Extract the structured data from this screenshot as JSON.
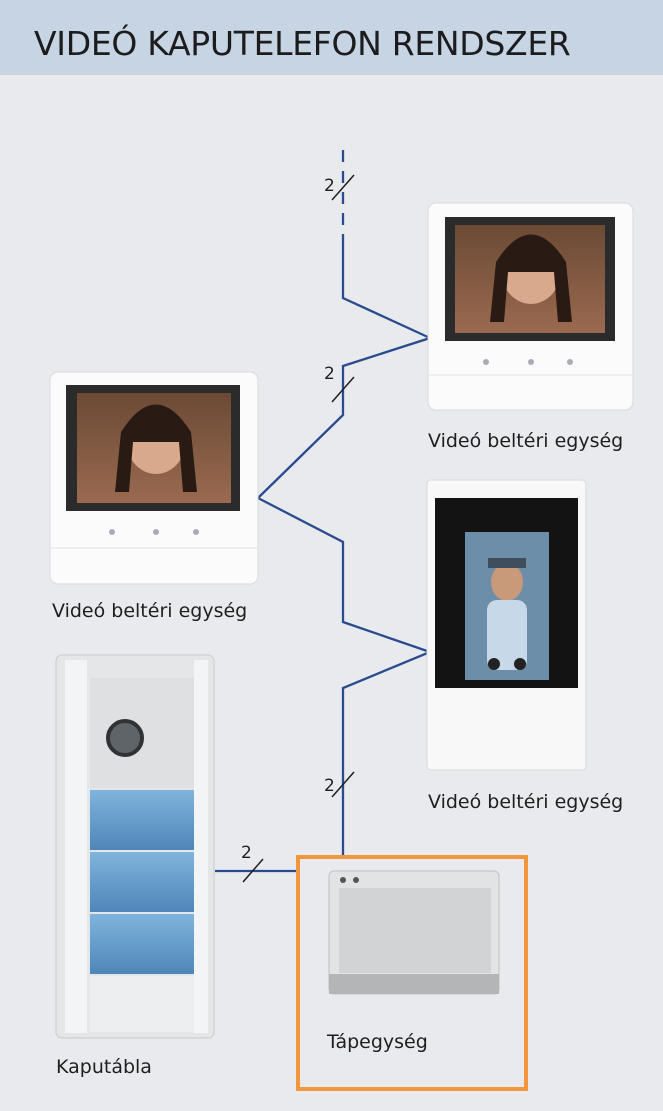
{
  "header": {
    "title": "VIDEÓ KAPUTELEFON RENDSZER"
  },
  "labels": {
    "indoor_top": "Videó beltéri egység",
    "indoor_left": "Videó beltéri egység",
    "indoor_touch": "Videó beltéri egység",
    "psu": "Tápegység",
    "entrance_panel": "Kaputábla"
  },
  "wires": {
    "riser_top": "2",
    "riser_mid": "2",
    "riser_low": "2",
    "panel_link": "2"
  },
  "colors": {
    "header_bg": "#c7d4e4",
    "wire": "#2a4c8e",
    "psu_frame": "#f3953a",
    "background": "#e9eaee"
  }
}
